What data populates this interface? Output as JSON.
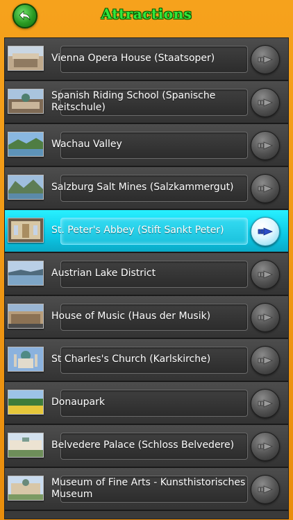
{
  "header": {
    "title": "Attractions",
    "back_icon": "back-arrow-icon"
  },
  "attractions": [
    {
      "name": "Vienna Opera House (Staatsoper)",
      "thumb": "opera-house"
    },
    {
      "name": "Spanish Riding School (Spanische Reitschule)",
      "thumb": "riding-school"
    },
    {
      "name": "Wachau Valley",
      "thumb": "valley"
    },
    {
      "name": "Salzburg Salt Mines (Salzkammergut)",
      "thumb": "salt-mines"
    },
    {
      "name": "St. Peter's Abbey (Stift Sankt Peter)",
      "thumb": "abbey",
      "selected": true
    },
    {
      "name": "Austrian Lake District",
      "thumb": "lake"
    },
    {
      "name": "House of Music (Haus der Musik)",
      "thumb": "music-house"
    },
    {
      "name": "St Charles's Church (Karlskirche)",
      "thumb": "church"
    },
    {
      "name": "Donaupark",
      "thumb": "park"
    },
    {
      "name": "Belvedere Palace (Schloss Belvedere)",
      "thumb": "palace"
    },
    {
      "name": "Museum of Fine Arts - Kunsthistorisches Museum",
      "thumb": "museum"
    }
  ],
  "colors": {
    "background": "#f19a14",
    "title_green": "#32e63a",
    "row_dark": "#3a3a3a",
    "row_selected": "#1fdcf5",
    "arrow_blue": "#2d4fc7"
  }
}
